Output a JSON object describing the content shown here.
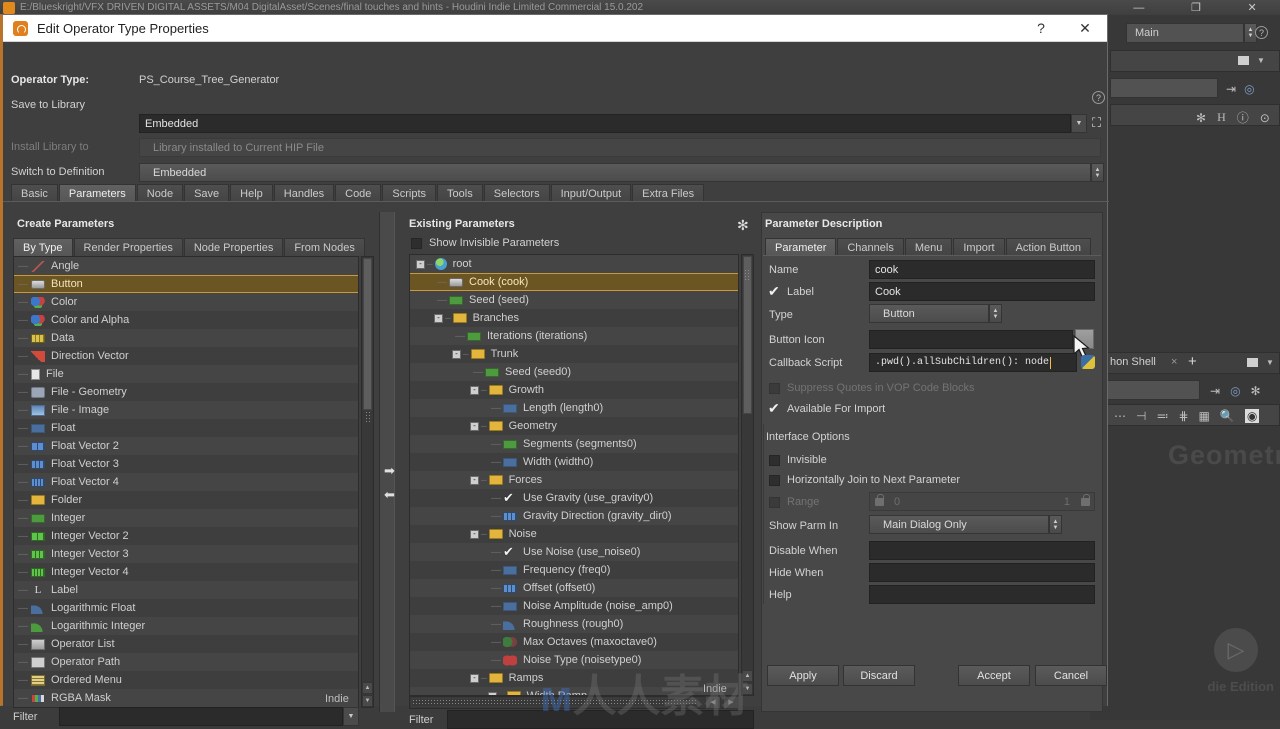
{
  "background": {
    "window_title": "E:/Blueskright/VFX DRIVEN DIGITAL ASSETS/M04 DigitalAsset/Scenes/final touches and hints - Houdini Indie Limited Commercial 15.0.202",
    "win_minimize": "—",
    "win_restore": "❐",
    "win_close": "✕",
    "main_combo": "Main",
    "shell_tab": "hon Shell",
    "shell_tab_close": "×",
    "shell_tab_add": "+",
    "viewport_watermark": "Geometry",
    "indie_edition_label": "die Edition",
    "site_watermark_prefix": "人人素材"
  },
  "dialog": {
    "title": "Edit Operator Type Properties",
    "titlebar_help": "?",
    "titlebar_close": "✕",
    "operator_type_label": "Operator Type:",
    "operator_type_value": "PS_Course_Tree_Generator",
    "save_to_library_label": "Save to Library",
    "save_to_library_value": "Embedded",
    "install_library_label": "Install Library to",
    "install_library_value": "Library installed to Current HIP File",
    "switch_definition_label": "Switch to Definition",
    "switch_definition_value": "Embedded",
    "help_icon": "?",
    "main_tabs": [
      {
        "label": "Basic",
        "active": false
      },
      {
        "label": "Parameters",
        "active": true
      },
      {
        "label": "Node",
        "active": false
      },
      {
        "label": "Save",
        "active": false
      },
      {
        "label": "Help",
        "active": false
      },
      {
        "label": "Handles",
        "active": false
      },
      {
        "label": "Code",
        "active": false
      },
      {
        "label": "Scripts",
        "active": false
      },
      {
        "label": "Tools",
        "active": false
      },
      {
        "label": "Selectors",
        "active": false
      },
      {
        "label": "Input/Output",
        "active": false
      },
      {
        "label": "Extra Files",
        "active": false
      }
    ]
  },
  "create_parameters": {
    "title": "Create Parameters",
    "tabs": [
      {
        "label": "By Type",
        "active": true
      },
      {
        "label": "Render Properties",
        "active": false
      },
      {
        "label": "Node Properties",
        "active": false
      },
      {
        "label": "From Nodes",
        "active": false
      }
    ],
    "items": [
      {
        "label": "Angle",
        "icon": "angle-icon",
        "selected": false
      },
      {
        "label": "Button",
        "icon": "button-icon",
        "selected": true
      },
      {
        "label": "Color",
        "icon": "color-icon",
        "selected": false
      },
      {
        "label": "Color and Alpha",
        "icon": "color-alpha-icon",
        "selected": false
      },
      {
        "label": "Data",
        "icon": "data-icon",
        "selected": false
      },
      {
        "label": "Direction Vector",
        "icon": "direction-vector-icon",
        "selected": false
      },
      {
        "label": "File",
        "icon": "file-icon",
        "selected": false
      },
      {
        "label": "File - Geometry",
        "icon": "file-geometry-icon",
        "selected": false
      },
      {
        "label": "File - Image",
        "icon": "file-image-icon",
        "selected": false
      },
      {
        "label": "Float",
        "icon": "float-icon",
        "selected": false
      },
      {
        "label": "Float Vector 2",
        "icon": "float-vector2-icon",
        "selected": false
      },
      {
        "label": "Float Vector 3",
        "icon": "float-vector3-icon",
        "selected": false
      },
      {
        "label": "Float Vector 4",
        "icon": "float-vector4-icon",
        "selected": false
      },
      {
        "label": "Folder",
        "icon": "folder-icon",
        "selected": false
      },
      {
        "label": "Integer",
        "icon": "integer-icon",
        "selected": false
      },
      {
        "label": "Integer Vector 2",
        "icon": "integer-vector2-icon",
        "selected": false
      },
      {
        "label": "Integer Vector 3",
        "icon": "integer-vector3-icon",
        "selected": false
      },
      {
        "label": "Integer Vector 4",
        "icon": "integer-vector4-icon",
        "selected": false
      },
      {
        "label": "Label",
        "icon": "label-icon",
        "selected": false
      },
      {
        "label": "Logarithmic Float",
        "icon": "log-float-icon",
        "selected": false
      },
      {
        "label": "Logarithmic Integer",
        "icon": "log-integer-icon",
        "selected": false
      },
      {
        "label": "Operator List",
        "icon": "operator-list-icon",
        "selected": false
      },
      {
        "label": "Operator Path",
        "icon": "operator-path-icon",
        "selected": false
      },
      {
        "label": "Ordered Menu",
        "icon": "ordered-menu-icon",
        "selected": false
      },
      {
        "label": "RGBA Mask",
        "icon": "rgba-mask-icon",
        "selected": false
      }
    ],
    "indie_tag": "Indie",
    "filter_label": "Filter",
    "filter_value": ""
  },
  "existing_parameters": {
    "title": "Existing Parameters",
    "show_invisible_label": "Show Invisible Parameters",
    "show_invisible_checked": false,
    "tree": [
      {
        "label": "root",
        "icon": "globe-icon",
        "indent": 0,
        "expander": "-",
        "selected": false
      },
      {
        "label": "Cook (cook)",
        "icon": "button-icon",
        "indent": 1,
        "expander": "",
        "selected": true
      },
      {
        "label": "Seed (seed)",
        "icon": "integer-icon",
        "indent": 1,
        "expander": "",
        "selected": false
      },
      {
        "label": "Branches",
        "icon": "folder-icon",
        "indent": 1,
        "expander": "-",
        "selected": false
      },
      {
        "label": "Iterations (iterations)",
        "icon": "integer-icon",
        "indent": 2,
        "expander": "",
        "selected": false
      },
      {
        "label": "Trunk",
        "icon": "folder-icon",
        "indent": 2,
        "expander": "-",
        "selected": false
      },
      {
        "label": "Seed (seed0)",
        "icon": "integer-icon",
        "indent": 3,
        "expander": "",
        "selected": false
      },
      {
        "label": "Growth",
        "icon": "folder-icon",
        "indent": 3,
        "expander": "-",
        "selected": false
      },
      {
        "label": "Length (length0)",
        "icon": "float-icon",
        "indent": 4,
        "expander": "",
        "selected": false
      },
      {
        "label": "Geometry",
        "icon": "folder-icon",
        "indent": 3,
        "expander": "-",
        "selected": false
      },
      {
        "label": "Segments (segments0)",
        "icon": "integer-icon",
        "indent": 4,
        "expander": "",
        "selected": false
      },
      {
        "label": "Width (width0)",
        "icon": "float-icon",
        "indent": 4,
        "expander": "",
        "selected": false
      },
      {
        "label": "Forces",
        "icon": "folder-icon",
        "indent": 3,
        "expander": "-",
        "selected": false
      },
      {
        "label": "Use Gravity (use_gravity0)",
        "icon": "toggle-icon",
        "indent": 4,
        "expander": "",
        "selected": false
      },
      {
        "label": "Gravity Direction (gravity_dir0)",
        "icon": "float-vector3-icon",
        "indent": 4,
        "expander": "",
        "selected": false
      },
      {
        "label": "Noise",
        "icon": "folder-icon",
        "indent": 3,
        "expander": "-",
        "selected": false
      },
      {
        "label": "Use Noise (use_noise0)",
        "icon": "toggle-icon",
        "indent": 4,
        "expander": "",
        "selected": false
      },
      {
        "label": "Frequency (freq0)",
        "icon": "float-icon",
        "indent": 4,
        "expander": "",
        "selected": false
      },
      {
        "label": "Offset (offset0)",
        "icon": "float-vector3-icon",
        "indent": 4,
        "expander": "",
        "selected": false
      },
      {
        "label": "Noise Amplitude (noise_amp0)",
        "icon": "float-icon",
        "indent": 4,
        "expander": "",
        "selected": false
      },
      {
        "label": "Roughness (rough0)",
        "icon": "log-float-icon",
        "indent": 4,
        "expander": "",
        "selected": false
      },
      {
        "label": "Max Octaves (maxoctave0)",
        "icon": "max-octave-icon",
        "indent": 4,
        "expander": "",
        "selected": false
      },
      {
        "label": "Noise Type (noisetype0)",
        "icon": "noise-type-icon",
        "indent": 4,
        "expander": "",
        "selected": false
      },
      {
        "label": "Ramps",
        "icon": "folder-icon",
        "indent": 3,
        "expander": "-",
        "selected": false
      },
      {
        "label": "Width Ramp",
        "icon": "folder-icon",
        "indent": 4,
        "expander": "-",
        "selected": false
      }
    ],
    "indie_tag": "Indie",
    "filter_label": "Filter",
    "filter_value": "",
    "gear_icon": "gear-icon"
  },
  "parameter_description": {
    "title": "Parameter Description",
    "tabs": [
      {
        "label": "Parameter",
        "active": true
      },
      {
        "label": "Channels",
        "active": false
      },
      {
        "label": "Menu",
        "active": false
      },
      {
        "label": "Import",
        "active": false
      },
      {
        "label": "Action Button",
        "active": false
      }
    ],
    "name_label": "Name",
    "name_value": "cook",
    "label_label": "Label",
    "label_value": "Cook",
    "label_checked": true,
    "type_label": "Type",
    "type_value": "Button",
    "button_icon_label": "Button Icon",
    "button_icon_value": "",
    "callback_script_label": "Callback Script",
    "callback_script_value": ".pwd().allSubChildren():    node",
    "suppress_quotes_label": "Suppress Quotes in VOP Code Blocks",
    "suppress_quotes_checked": false,
    "available_for_import_label": "Available For Import",
    "available_for_import_checked": true,
    "interface_options_title": "Interface Options",
    "invisible_label": "Invisible",
    "invisible_checked": false,
    "hjoin_label": "Horizontally Join to Next Parameter",
    "hjoin_checked": false,
    "range_label": "Range",
    "range_min": "0",
    "range_max": "1",
    "show_parm_in_label": "Show Parm In",
    "show_parm_in_value": "Main Dialog Only",
    "disable_when_label": "Disable When",
    "disable_when_value": "",
    "hide_when_label": "Hide When",
    "hide_when_value": "",
    "help_label": "Help",
    "help_value": ""
  },
  "footer": {
    "buttons": [
      {
        "label": "Apply",
        "name": "apply-button"
      },
      {
        "label": "Discard",
        "name": "discard-button"
      },
      {
        "label": "Accept",
        "name": "accept-button"
      },
      {
        "label": "Cancel",
        "name": "cancel-button"
      }
    ]
  },
  "colors": {
    "selection": "#6b5522",
    "selection_border": "#c79a3e",
    "accent_orange": "#b8742a",
    "panel_bg": "#3f3f3f",
    "field_bg": "#2b2b2b"
  }
}
